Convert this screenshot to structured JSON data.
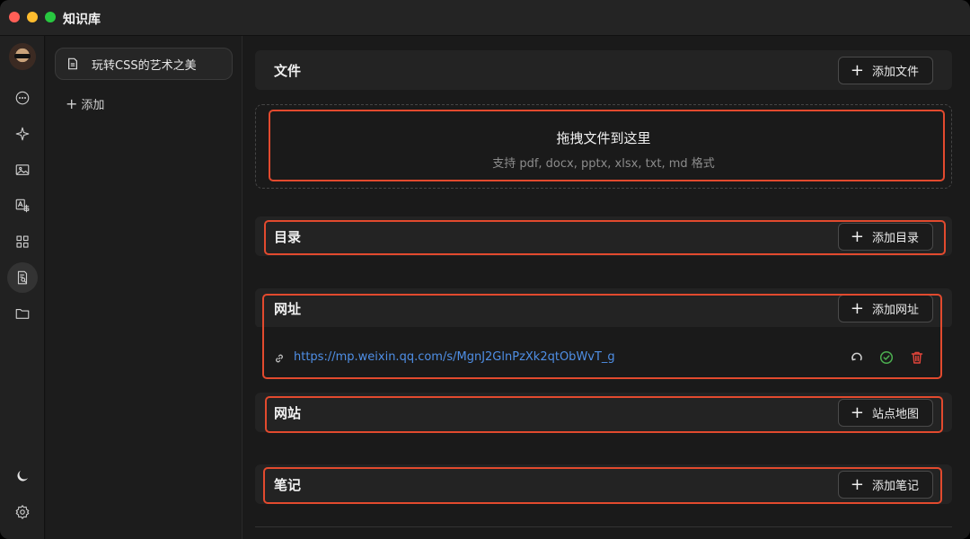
{
  "app": {
    "title": "知识库"
  },
  "list": {
    "items": [
      {
        "label": "玩转CSS的艺术之美"
      }
    ],
    "add_label": "添加"
  },
  "sections": {
    "files": {
      "title": "文件",
      "button": "添加文件"
    },
    "dropzone": {
      "title": "拖拽文件到这里",
      "subtitle": "支持 pdf, docx, pptx, xlsx, txt, md 格式"
    },
    "directory": {
      "title": "目录",
      "button": "添加目录"
    },
    "urls": {
      "title": "网址",
      "button": "添加网址",
      "items": [
        {
          "url": "https://mp.weixin.qq.com/s/MgnJ2GlnPzXk2qtObWvT_g"
        }
      ]
    },
    "website": {
      "title": "网站",
      "button": "站点地图"
    },
    "notes": {
      "title": "笔记",
      "button": "添加笔记"
    }
  },
  "colors": {
    "accent_red": "#e24a2e",
    "link_blue": "#4f8fe6",
    "success_green": "#4caf50",
    "danger_red": "#e0443a"
  },
  "icons": [
    "chat-icon",
    "sparkle-icon",
    "image-icon",
    "translate-icon",
    "apps-icon",
    "knowledge-icon",
    "folder-icon",
    "moon-icon",
    "settings-icon"
  ]
}
